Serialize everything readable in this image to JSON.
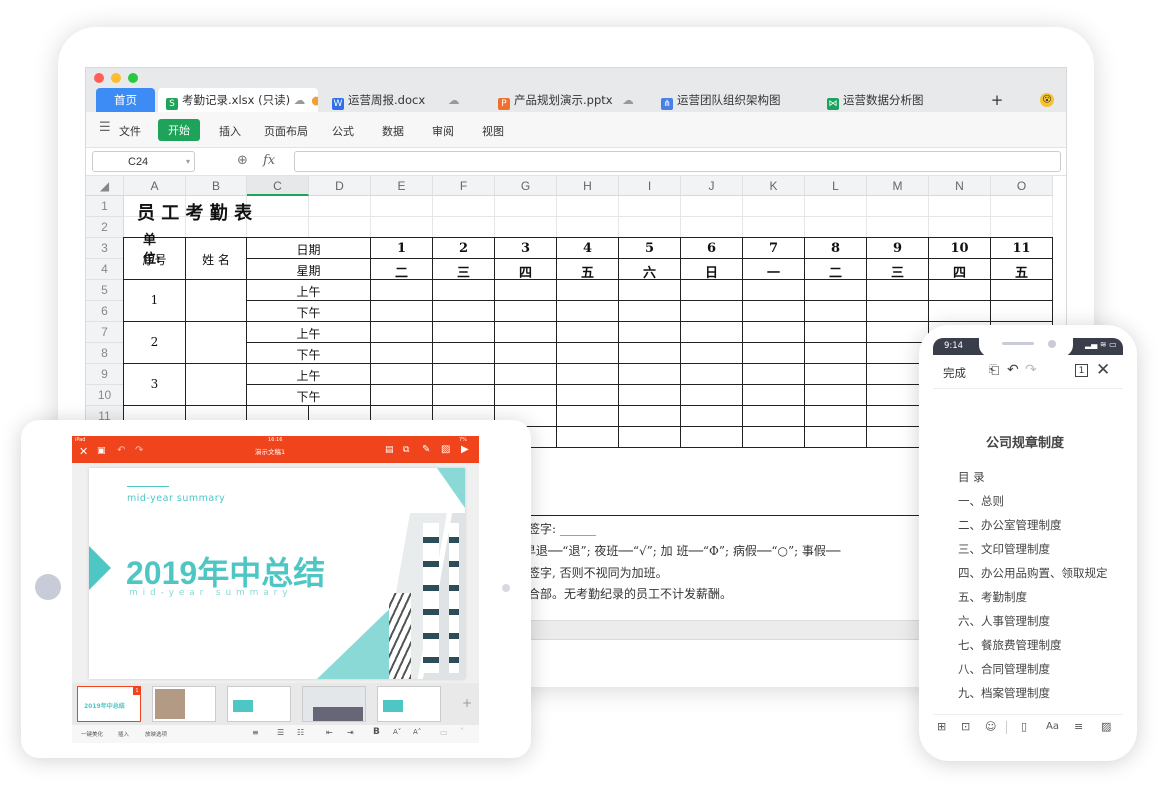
{
  "laptop": {
    "tabs": [
      {
        "label": "首页"
      },
      {
        "label": "考勤记录.xlsx (只读)",
        "icon": "spreadsheet-icon",
        "color": "#1fa35b"
      },
      {
        "label": "运营周报.docx",
        "icon": "document-icon",
        "color": "#2f6fe8"
      },
      {
        "label": "产品规划演示.pptx",
        "icon": "presentation-icon",
        "color": "#f07030"
      },
      {
        "label": "运营团队组织架构图",
        "icon": "orgchart-icon",
        "color": "#4a7fe6"
      },
      {
        "label": "运营数据分析图",
        "icon": "mindmap-icon",
        "color": "#19a35f"
      }
    ],
    "add_tab": "+",
    "menus": [
      "文件",
      "开始",
      "插入",
      "页面布局",
      "公式",
      "数据",
      "审阅",
      "视图"
    ],
    "active_menu": "开始",
    "name_box": "C24",
    "fx": "fx",
    "columns": [
      "A",
      "B",
      "C",
      "D",
      "E",
      "F",
      "G",
      "H",
      "I",
      "J",
      "K",
      "L",
      "M",
      "N",
      "O"
    ],
    "rows": [
      "1",
      "2",
      "3",
      "4",
      "5",
      "6",
      "7",
      "8",
      "9",
      "10",
      "11"
    ],
    "sheet": {
      "title": "员 工 考 勤 表",
      "unit": "单位:",
      "seq_header": "序号",
      "name_header": "姓 名",
      "date_label": "日期",
      "week_label": "星期",
      "dates": [
        "1",
        "2",
        "3",
        "4",
        "5",
        "6",
        "7",
        "8",
        "9",
        "10",
        "11"
      ],
      "weekdays": [
        "二",
        "三",
        "四",
        "五",
        "六",
        "日",
        "一",
        "二",
        "三",
        "四",
        "五"
      ],
      "seq": [
        "1",
        "2",
        "3"
      ],
      "am": "上午",
      "pm": "下午"
    },
    "notes": [
      "员签字: ______",
      "; 早退──“退”; 夜班──“√”; 加 班──“Φ”; 病假──“○”; 事假──",
      "的签字, 否则不视同为加班。",
      "综合部。无考勤纪录的员工不计发薪酬。"
    ]
  },
  "ipad": {
    "status_left": "iPad",
    "status_time": "16:16",
    "status_right": "7%",
    "doc_title": "演示文稿1",
    "slide": {
      "kicker": "mid-year summary",
      "title": "2019年中总结",
      "subtitle": "m i d - y e a r   s u m m a r y"
    },
    "thumb_title": "2019年中总结",
    "slide_number": "1",
    "bottom_left": [
      "一键美化",
      "插入",
      "放映选项"
    ],
    "accent": "#f0441c",
    "teal": "#4ec7c4"
  },
  "phone": {
    "time": "9:14",
    "done": "完成",
    "page_count": "1",
    "doc_title": "公司规章制度",
    "toc": [
      "目 录",
      "一、总则",
      "二、办公室管理制度",
      "三、文印管理制度",
      "四、办公用品购置、领取规定",
      "五、考勤制度",
      "六、人事管理制度",
      "七、餐旅费管理制度",
      "八、合同管理制度",
      "九、档案管理制度"
    ]
  }
}
